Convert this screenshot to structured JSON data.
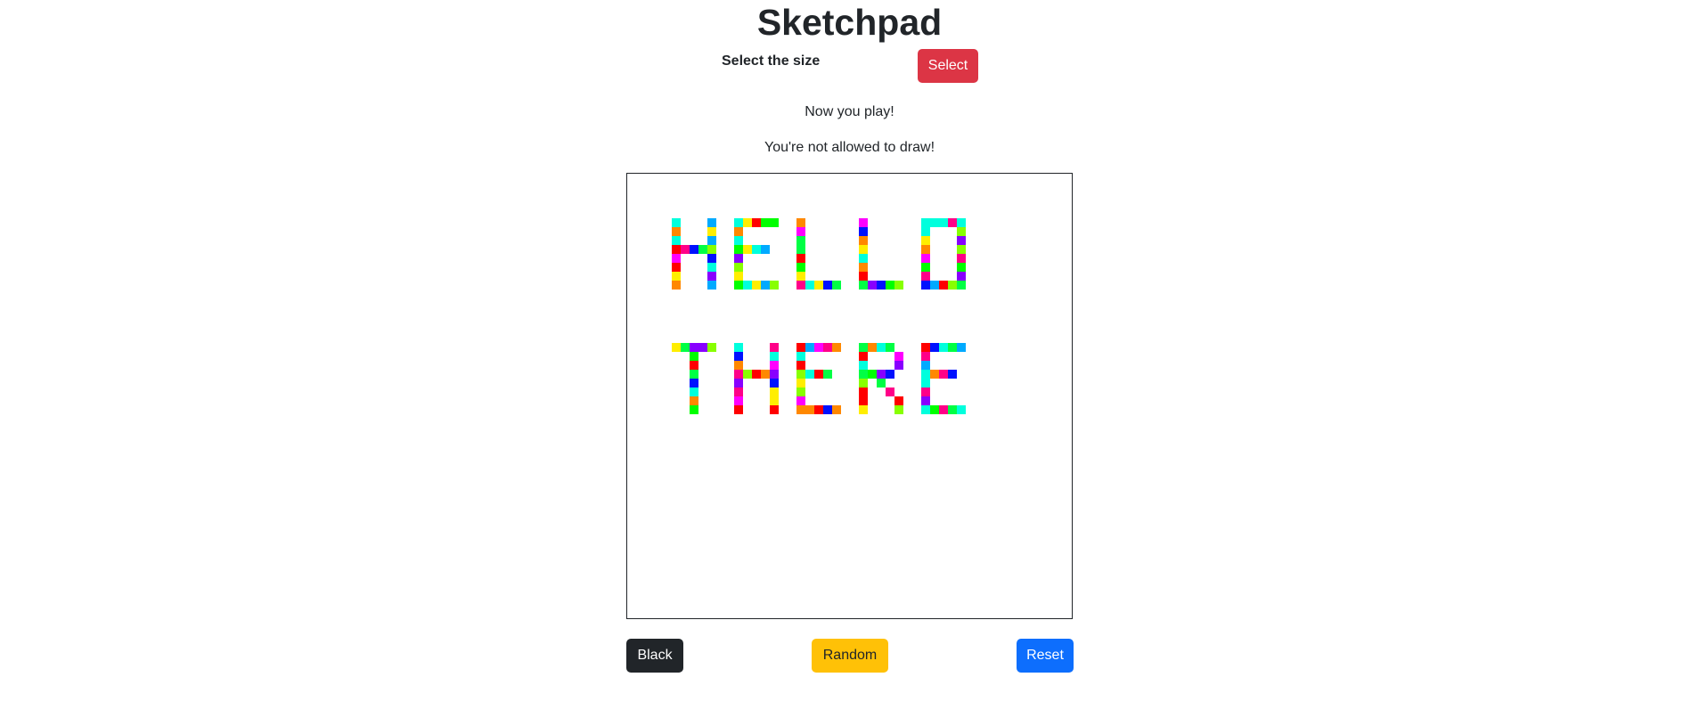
{
  "header": {
    "title": "Sketchpad"
  },
  "size_control": {
    "label": "Select the size",
    "button_label": "Select"
  },
  "messages": {
    "play": "Now you play!",
    "draw": "You're not allowed to draw!"
  },
  "controls": {
    "black_label": "Black",
    "random_label": "Random",
    "reset_label": "Reset"
  },
  "theme": {
    "select_color": "#dc3545",
    "black_color": "#212529",
    "random_color": "#ffc107",
    "reset_color": "#0d6efd"
  },
  "sketch": {
    "grid_size": 50,
    "palette": [
      "#ff0000",
      "#ff8800",
      "#ffee00",
      "#88ff00",
      "#00ff44",
      "#00ffdd",
      "#00aaff",
      "#0011ff",
      "#8800ff",
      "#ff00ff",
      "#ff0088",
      "#00ff00"
    ],
    "drawing_text": [
      "HELLO",
      "THERE"
    ]
  }
}
